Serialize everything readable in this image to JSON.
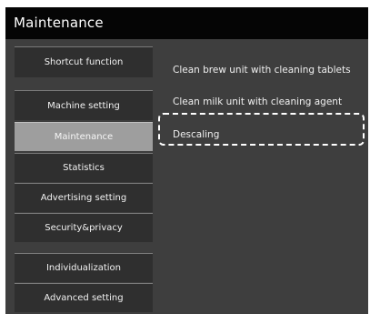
{
  "header": {
    "title": "Maintenance"
  },
  "sidebar": {
    "items": [
      {
        "label": "Shortcut function"
      },
      {
        "label": "Machine setting"
      },
      {
        "label": "Maintenance"
      },
      {
        "label": "Statistics"
      },
      {
        "label": "Advertising setting"
      },
      {
        "label": "Security&privacy"
      },
      {
        "label": "Individualization"
      },
      {
        "label": "Advanced setting"
      }
    ],
    "selected": "Maintenance"
  },
  "main": {
    "items": [
      {
        "label": "Clean brew unit with cleaning tablets"
      },
      {
        "label": "Clean milk unit with cleaning agent"
      },
      {
        "label": "Descaling"
      }
    ],
    "focused": "Descaling"
  },
  "colors": {
    "titlebar": "#050505",
    "background": "#3e3e3e",
    "menu_item": "#2f2f2f",
    "menu_selected": "#9e9e9e",
    "focus_outline": "#ffffff"
  }
}
